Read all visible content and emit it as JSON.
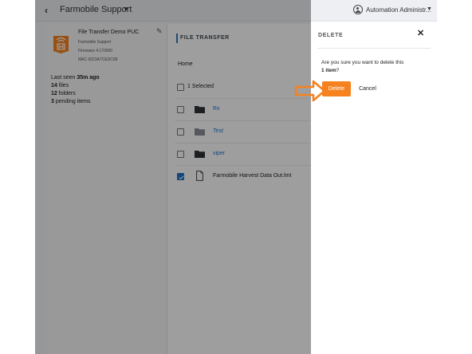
{
  "topbar": {
    "back_glyph": "‹",
    "app_title": "Farmobile Support",
    "caret": "▼",
    "user_name": "Automation Administr..."
  },
  "device": {
    "name": "File Transfer Demo PUC",
    "org": "Farmobile Support",
    "firmware": "Firmware 4.170000",
    "mac": "MAC 0023A7CEDC68",
    "logo_color": "#f5821f",
    "last_seen_label": "Last seen",
    "last_seen_value": "35m ago",
    "files_count": "14",
    "files_label": "files",
    "folders_count": "12",
    "folders_label": "folders",
    "pending_count": "3",
    "pending_label": "pending items"
  },
  "main": {
    "section_title": "FILE TRANSFER",
    "breadcrumb_home": "Home",
    "selected_text": "1 Selected",
    "items": [
      {
        "label": "Rx",
        "type": "folder",
        "checked": false,
        "italic": false
      },
      {
        "label": "Test",
        "type": "folder-light",
        "checked": false,
        "italic": true
      },
      {
        "label": "viper",
        "type": "folder",
        "checked": false,
        "italic": false
      },
      {
        "label": "Farmobile Harvest Data Out.lmt",
        "type": "file",
        "checked": true,
        "italic": false
      }
    ]
  },
  "dialog": {
    "title": "DELETE",
    "close_glyph": "✕",
    "confirm_line1": "Are you sure you want to delete this",
    "confirm_count": "1 item",
    "confirm_suffix": "?",
    "delete_label": "Delete",
    "cancel_label": "Cancel"
  },
  "colors": {
    "accent": "#f5821f",
    "link": "#1a73c8",
    "section_bar": "#3b7bbf"
  }
}
